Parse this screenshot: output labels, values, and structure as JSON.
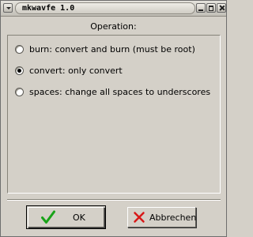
{
  "window": {
    "title": "mkwavfe 1.0"
  },
  "dialog": {
    "heading": "Operation:",
    "options": [
      {
        "label": "burn: convert and burn (must be root)",
        "checked": false
      },
      {
        "label": "convert: only convert",
        "checked": true
      },
      {
        "label": "spaces: change all spaces to underscores",
        "checked": false
      }
    ]
  },
  "buttons": {
    "ok_label": "OK",
    "cancel_label": "Abbrechen"
  },
  "icons": {
    "ok": "checkmark-icon",
    "cancel": "red-x-icon",
    "ok_color": "#19a319",
    "cancel_color": "#d81818"
  }
}
